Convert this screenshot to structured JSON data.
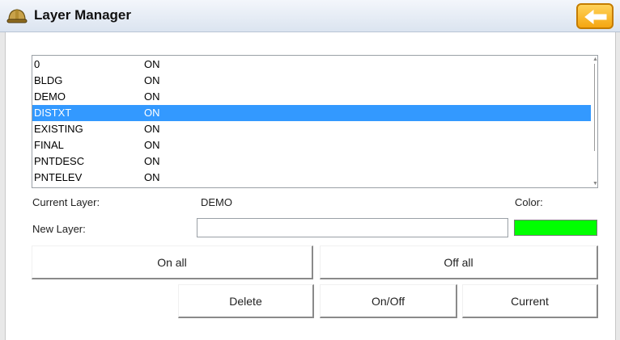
{
  "window": {
    "title": "Layer Manager",
    "app_icon": "hard-hat-icon",
    "back_icon": "back-arrow-icon"
  },
  "layers": [
    {
      "name": "0",
      "state": "ON",
      "selected": false
    },
    {
      "name": "BLDG",
      "state": "ON",
      "selected": false
    },
    {
      "name": "DEMO",
      "state": "ON",
      "selected": false
    },
    {
      "name": "DISTXT",
      "state": "ON",
      "selected": true
    },
    {
      "name": "EXISTING",
      "state": "ON",
      "selected": false
    },
    {
      "name": "FINAL",
      "state": "ON",
      "selected": false
    },
    {
      "name": "PNTDESC",
      "state": "ON",
      "selected": false
    },
    {
      "name": "PNTELEV",
      "state": "ON",
      "selected": false
    }
  ],
  "current_layer": {
    "label": "Current Layer:",
    "value": "DEMO"
  },
  "color": {
    "label": "Color:",
    "value": "#00ff00"
  },
  "new_layer": {
    "label": "New Layer:",
    "value": "",
    "placeholder": ""
  },
  "buttons": {
    "on_all": "On all",
    "off_all": "Off all",
    "delete": "Delete",
    "on_off": "On/Off",
    "current": "Current"
  },
  "colors": {
    "selection": "#3399ff",
    "accent": "#f5a611"
  }
}
